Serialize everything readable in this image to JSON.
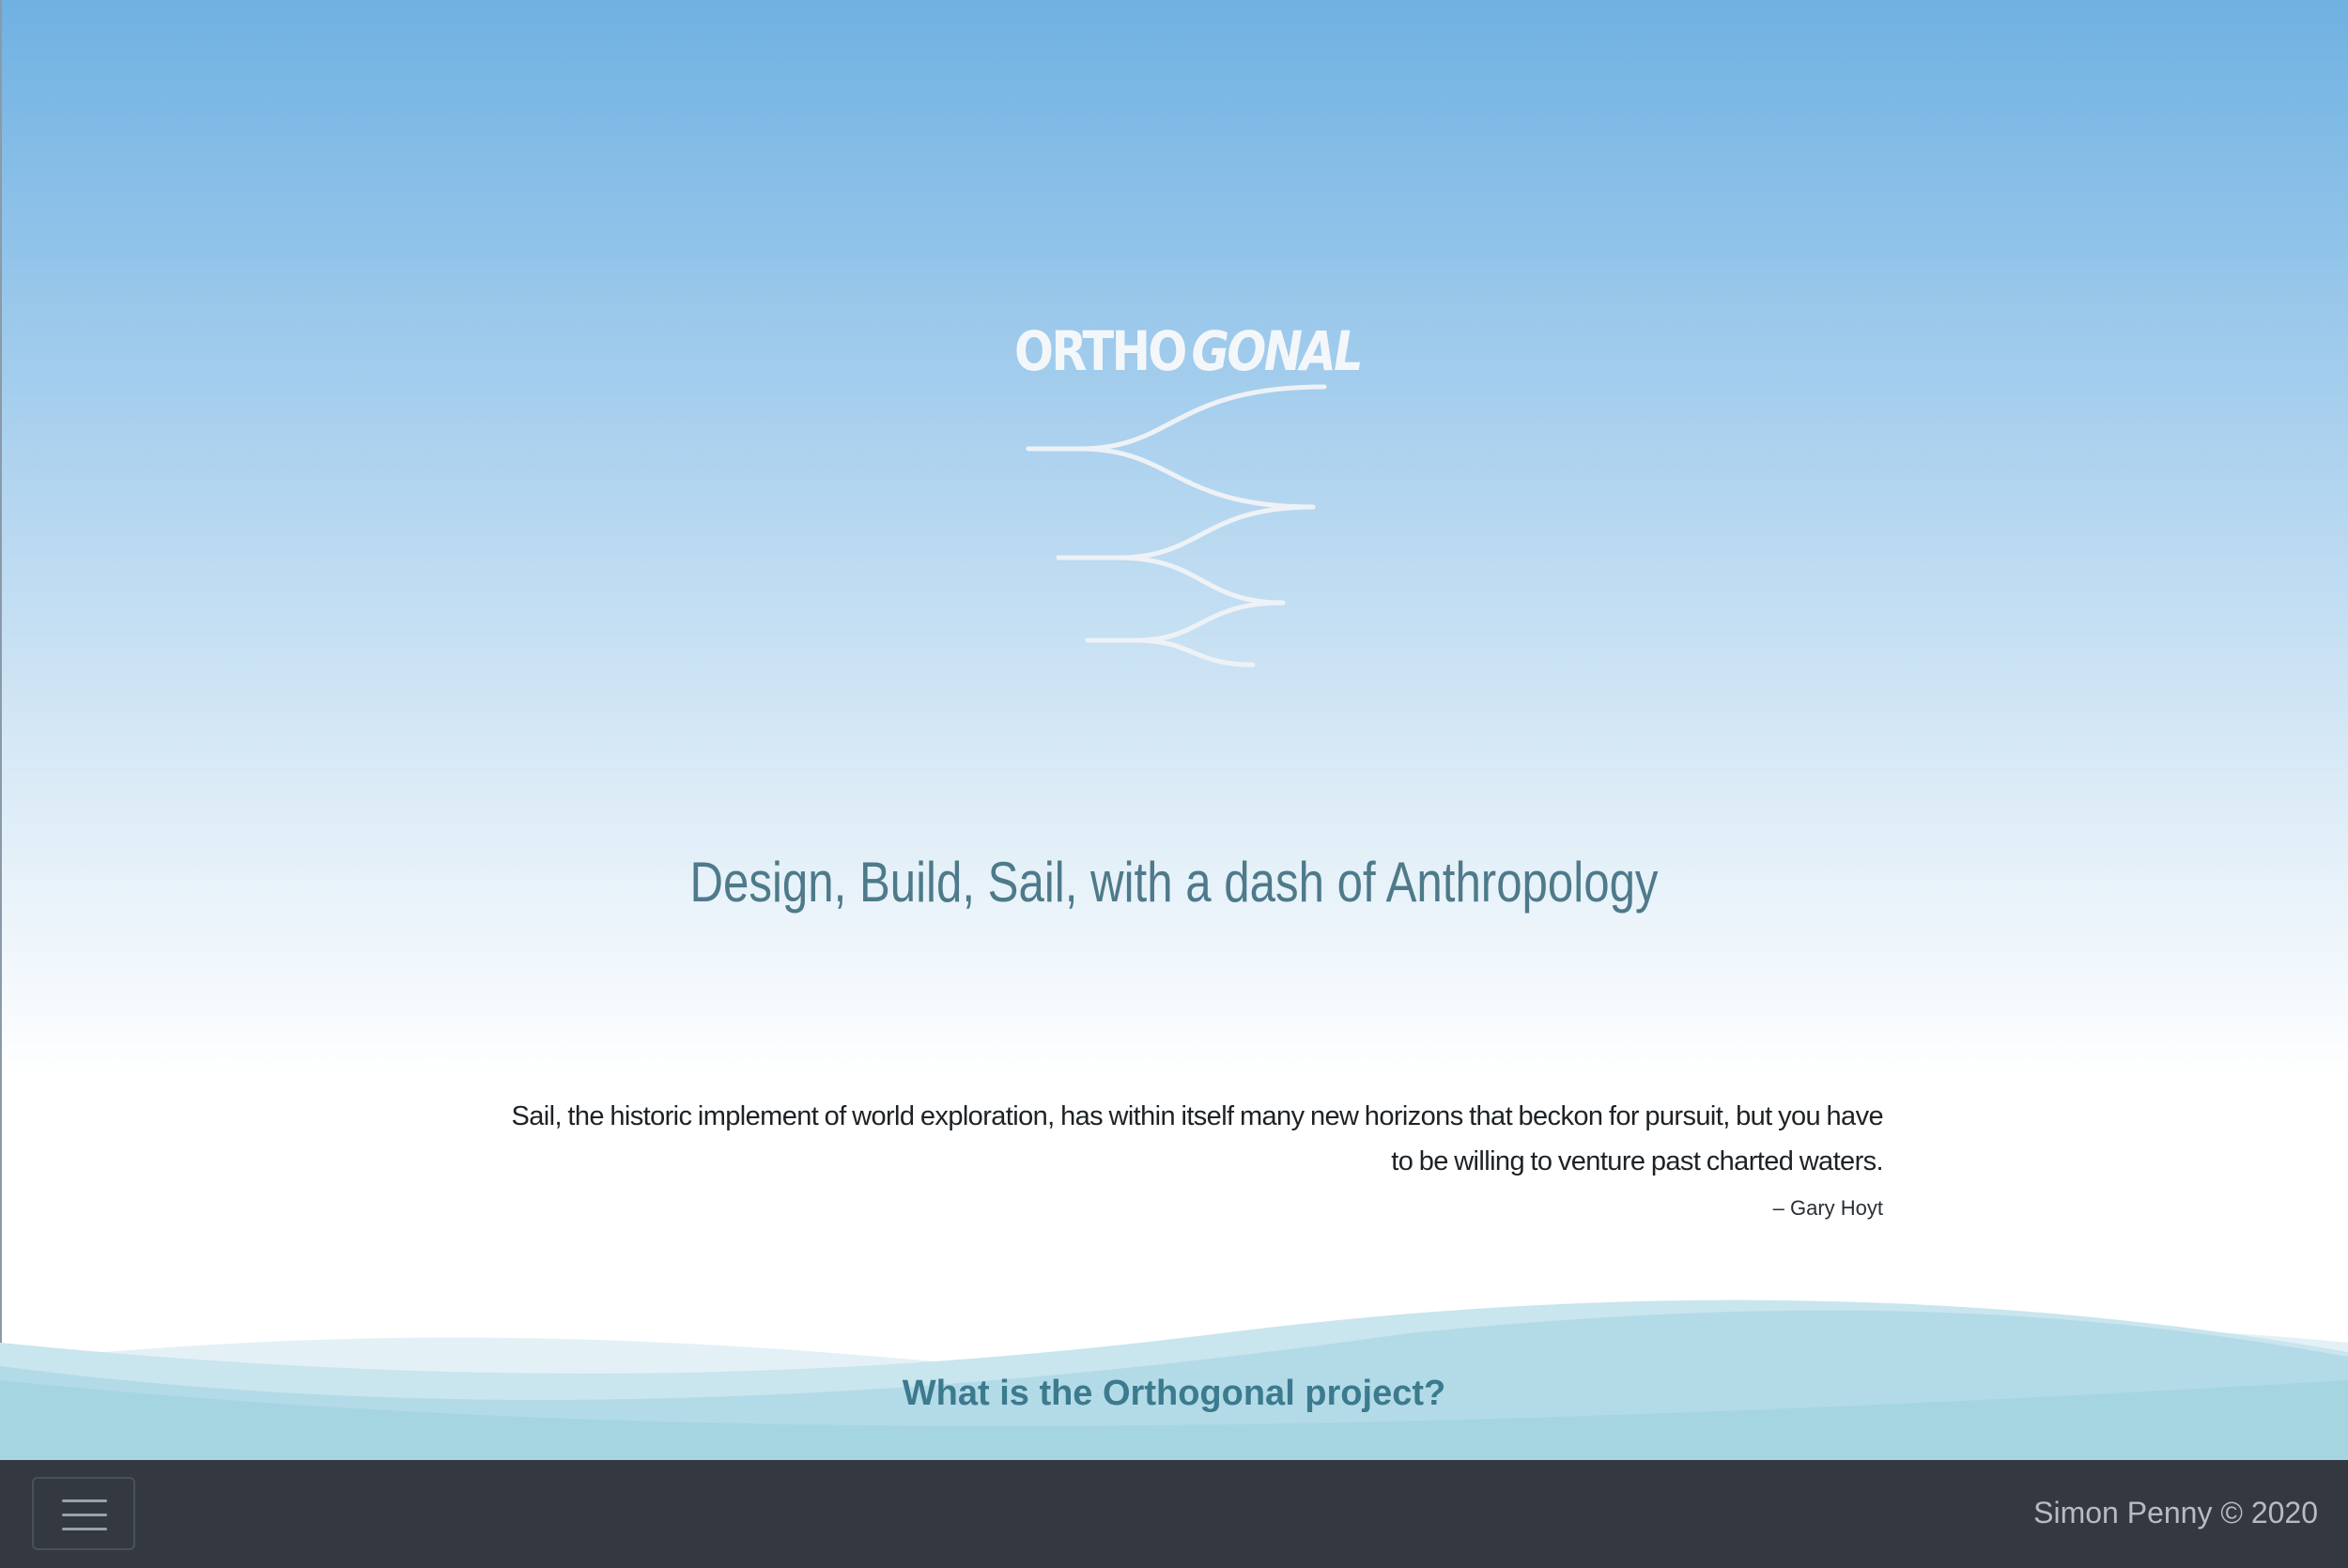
{
  "logo": {
    "word_regular": "ORTHO",
    "word_italic": "GONAL",
    "icon": "branching-lines-logo"
  },
  "hero": {
    "tagline": "Design, Build, Sail, with a dash of Anthropology"
  },
  "quote": {
    "text": "Sail, the historic implement of world exploration, has within itself many new horizons that beckon for pursuit, but you have to be willing to venture past charted waters.",
    "author": "– Gary Hoyt"
  },
  "section": {
    "link_label": "What is the Orthogonal project?"
  },
  "footer": {
    "menu_icon": "hamburger-menu-icon",
    "copyright": "Simon Penny © 2020"
  },
  "colors": {
    "sky_top": "#6fb1e2",
    "sky_bottom": "#ffffff",
    "tagline": "#4e7a8a",
    "wave": "#a6d5e2",
    "footer_bg": "#343941"
  }
}
